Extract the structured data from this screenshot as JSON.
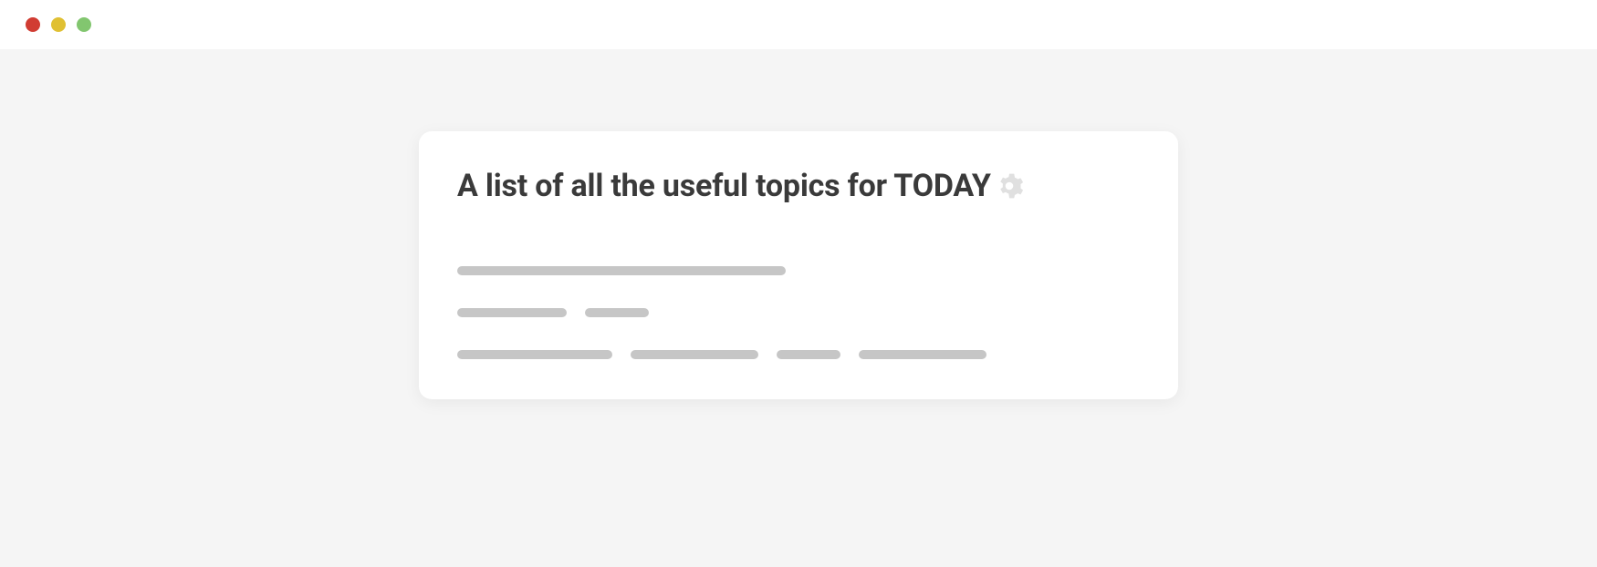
{
  "card": {
    "title": "A list of all the useful topics for TODAY",
    "gear_icon": "gear"
  },
  "placeholders": {
    "row1": [
      360
    ],
    "row2": [
      120,
      70
    ],
    "row3": [
      170,
      140,
      70,
      140
    ]
  }
}
